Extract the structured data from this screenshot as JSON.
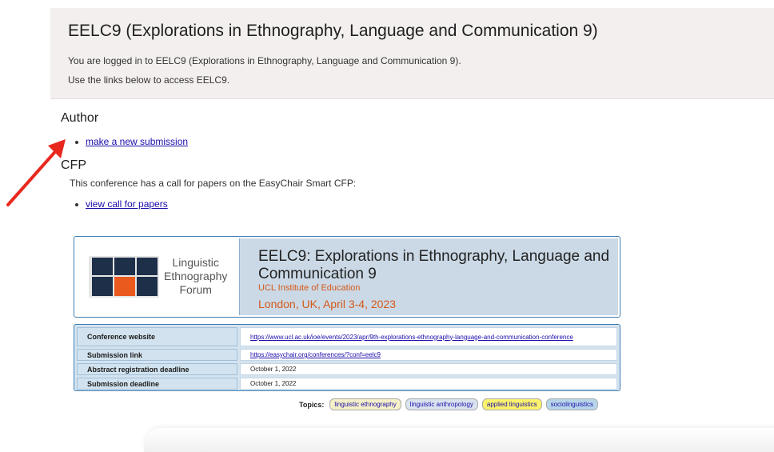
{
  "welcome": {
    "title": "EELC9 (Explorations in Ethnography, Language and Communication 9)",
    "logged_in_text": "You are logged in to EELC9 (Explorations in Ethnography, Language and Communication 9).",
    "links_text": "Use the links below to access EELC9."
  },
  "author": {
    "heading": "Author",
    "new_submission_link": "make a new submission"
  },
  "cfp": {
    "heading": "CFP",
    "description": "This conference has a call for papers on the EasyChair Smart CFP:",
    "view_link": "view call for papers"
  },
  "conference": {
    "logo_text_line1": "Linguistic",
    "logo_text_line2": "Ethnography",
    "logo_text_line3": "Forum",
    "title": "EELC9: Explorations in Ethnography, Language and Communication 9",
    "institution": "UCL Institute of Education",
    "location": "London, UK, April 3-4, 2023"
  },
  "info_table": [
    {
      "label": "Conference website",
      "value": "https://www.ucl.ac.uk/ioe/events/2023/apr/9th-explorations-ethnography-language-and-communication-conference",
      "is_link": true
    },
    {
      "label": "Submission link",
      "value": "https://easychair.org/conferences/?conf=eelc9",
      "is_link": true
    },
    {
      "label": "Abstract registration deadline",
      "value": "October 1, 2022",
      "is_link": false
    },
    {
      "label": "Submission deadline",
      "value": "October 1, 2022",
      "is_link": false
    }
  ],
  "topics": {
    "label": "Topics:",
    "items": [
      {
        "text": "linguistic ethnography",
        "color": "#f5f0c8"
      },
      {
        "text": "linguistic anthropology",
        "color": "#d9e3ee"
      },
      {
        "text": "applied linguistics",
        "color": "#fbf36b"
      },
      {
        "text": "sociolinguistics",
        "color": "#b8d6ea"
      }
    ]
  },
  "colors": {
    "arrow": "#e8281e",
    "accent_orange": "#d4581a",
    "link": "#1a0dab"
  }
}
